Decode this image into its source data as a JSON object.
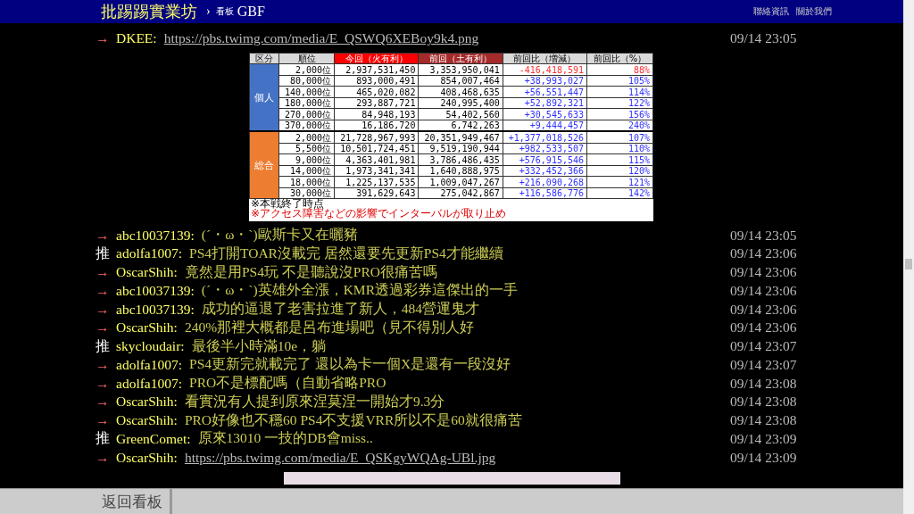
{
  "header": {
    "site": "批踢踢實業坊",
    "separator": "›",
    "board_label": "看板",
    "board": "GBF",
    "links": [
      "聯絡資訊",
      "關於我們"
    ]
  },
  "pushes_before": [
    {
      "kind": "arrow",
      "tag": "→",
      "user": "DKEE:",
      "content": "https://pbs.twimg.com/media/E_QSWQ6XEBoy9k4.png",
      "link": true,
      "time": "09/14 23:05"
    }
  ],
  "image_table": {
    "columns": [
      {
        "label": "区分",
        "kind": "plain"
      },
      {
        "label": "順位",
        "kind": "plain"
      },
      {
        "label": "今回（火有利）",
        "kind": "current"
      },
      {
        "label": "前回（土有利）",
        "kind": "previous"
      },
      {
        "label": "前回比（増減）",
        "kind": "plain"
      },
      {
        "label": "前回比（%）",
        "kind": "plain"
      }
    ],
    "groups": [
      {
        "label": "個人",
        "color": "#4472c4",
        "rows": [
          {
            "rank": "2,000位",
            "current": "2,937,531,450",
            "previous": "3,353,950,041",
            "change": "-416,418,591",
            "percent": "88%",
            "color": "#ff3030"
          },
          {
            "rank": "80,000位",
            "current": "893,000,491",
            "previous": "854,007,464",
            "change": "+38,993,027",
            "percent": "105%",
            "color": "#3030ff"
          },
          {
            "rank": "140,000位",
            "current": "465,020,082",
            "previous": "408,468,635",
            "change": "+56,551,447",
            "percent": "114%",
            "color": "#3030ff"
          },
          {
            "rank": "180,000位",
            "current": "293,887,721",
            "previous": "240,995,400",
            "change": "+52,892,321",
            "percent": "122%",
            "color": "#3030ff"
          },
          {
            "rank": "270,000位",
            "current": "84,948,193",
            "previous": "54,402,560",
            "change": "+30,545,633",
            "percent": "156%",
            "color": "#3030ff"
          },
          {
            "rank": "370,000位",
            "current": "16,186,720",
            "previous": "6,742,263",
            "change": "+9,444,457",
            "percent": "240%",
            "color": "#3030ff"
          }
        ]
      },
      {
        "label": "総合",
        "color": "#ed7d31",
        "rows": [
          {
            "rank": "2,000位",
            "current": "21,728,967,993",
            "previous": "20,351,949,467",
            "change": "+1,377,018,526",
            "percent": "107%",
            "color": "#3030ff"
          },
          {
            "rank": "5,500位",
            "current": "10,501,724,451",
            "previous": "9,519,190,944",
            "change": "+982,533,507",
            "percent": "110%",
            "color": "#3030ff"
          },
          {
            "rank": "9,000位",
            "current": "4,363,401,981",
            "previous": "3,786,486,435",
            "change": "+576,915,546",
            "percent": "115%",
            "color": "#3030ff"
          },
          {
            "rank": "14,000位",
            "current": "1,973,341,341",
            "previous": "1,640,888,975",
            "change": "+332,452,366",
            "percent": "120%",
            "color": "#3030ff"
          },
          {
            "rank": "18,000位",
            "current": "1,225,137,535",
            "previous": "1,009,047,267",
            "change": "+216,090,268",
            "percent": "121%",
            "color": "#3030ff"
          },
          {
            "rank": "30,000位",
            "current": "391,629,643",
            "previous": "275,042,867",
            "change": "+116,586,776",
            "percent": "142%",
            "color": "#3030ff"
          }
        ]
      }
    ],
    "notes": [
      {
        "text": "※本戦終了時点",
        "kind": "normal"
      },
      {
        "text": "※アクセス障害などの影響でインターバルが取り止め",
        "kind": "warning"
      }
    ]
  },
  "pushes": [
    {
      "kind": "arrow",
      "tag": "→",
      "user": "abc10037139:",
      "content": "(´・ω・`)歐斯卡又在曬豬",
      "link": false,
      "time": "09/14 23:05"
    },
    {
      "kind": "push",
      "tag": "推",
      "user": "adolfa1007:",
      "content": "PS4打開TOAR沒載完 居然還要先更新PS4才能繼續",
      "link": false,
      "time": "09/14 23:06"
    },
    {
      "kind": "arrow",
      "tag": "→",
      "user": "OscarShih:",
      "content": "竟然是用PS4玩 不是聽說沒PRO很痛苦嗎",
      "link": false,
      "time": "09/14 23:06"
    },
    {
      "kind": "arrow",
      "tag": "→",
      "user": "abc10037139:",
      "content": "(´・ω・`)英雄外全漲，KMR透過彩券這傑出的一手",
      "link": false,
      "time": "09/14 23:06"
    },
    {
      "kind": "arrow",
      "tag": "→",
      "user": "abc10037139:",
      "content": "成功的逼退了老害拉進了新人，484營運鬼才",
      "link": false,
      "time": "09/14 23:06"
    },
    {
      "kind": "arrow",
      "tag": "→",
      "user": "OscarShih:",
      "content": "240%那裡大概都是呂布進場吧（見不得別人好",
      "link": false,
      "time": "09/14 23:06"
    },
    {
      "kind": "push",
      "tag": "推",
      "user": "skycloudair:",
      "content": "最後半小時滿10e，躺",
      "link": false,
      "time": "09/14 23:07"
    },
    {
      "kind": "arrow",
      "tag": "→",
      "user": "adolfa1007:",
      "content": "PS4更新完就載完了 還以為卡一個X是還有一段沒好",
      "link": false,
      "time": "09/14 23:07"
    },
    {
      "kind": "arrow",
      "tag": "→",
      "user": "adolfa1007:",
      "content": "PRO不是標配嗎（自動省略PRO",
      "link": false,
      "time": "09/14 23:08"
    },
    {
      "kind": "arrow",
      "tag": "→",
      "user": "OscarShih:",
      "content": "看實況有人提到原來涅莫涅一開始才9.3分",
      "link": false,
      "time": "09/14 23:08"
    },
    {
      "kind": "arrow",
      "tag": "→",
      "user": "OscarShih:",
      "content": "PRO好像也不穩60 PS4不支援VRR所以不是60就很痛苦",
      "link": false,
      "time": "09/14 23:08"
    },
    {
      "kind": "push",
      "tag": "推",
      "user": "GreenComet:",
      "content": "原來13010 一技的DB會miss..",
      "link": false,
      "time": "09/14 23:09"
    },
    {
      "kind": "arrow",
      "tag": "→",
      "user": "OscarShih:",
      "content": "https://pbs.twimg.com/media/E_QSKgyWQAg-UBl.jpg",
      "link": true,
      "time": "09/14 23:09"
    }
  ],
  "footer": {
    "back_button": "返回看板"
  }
}
